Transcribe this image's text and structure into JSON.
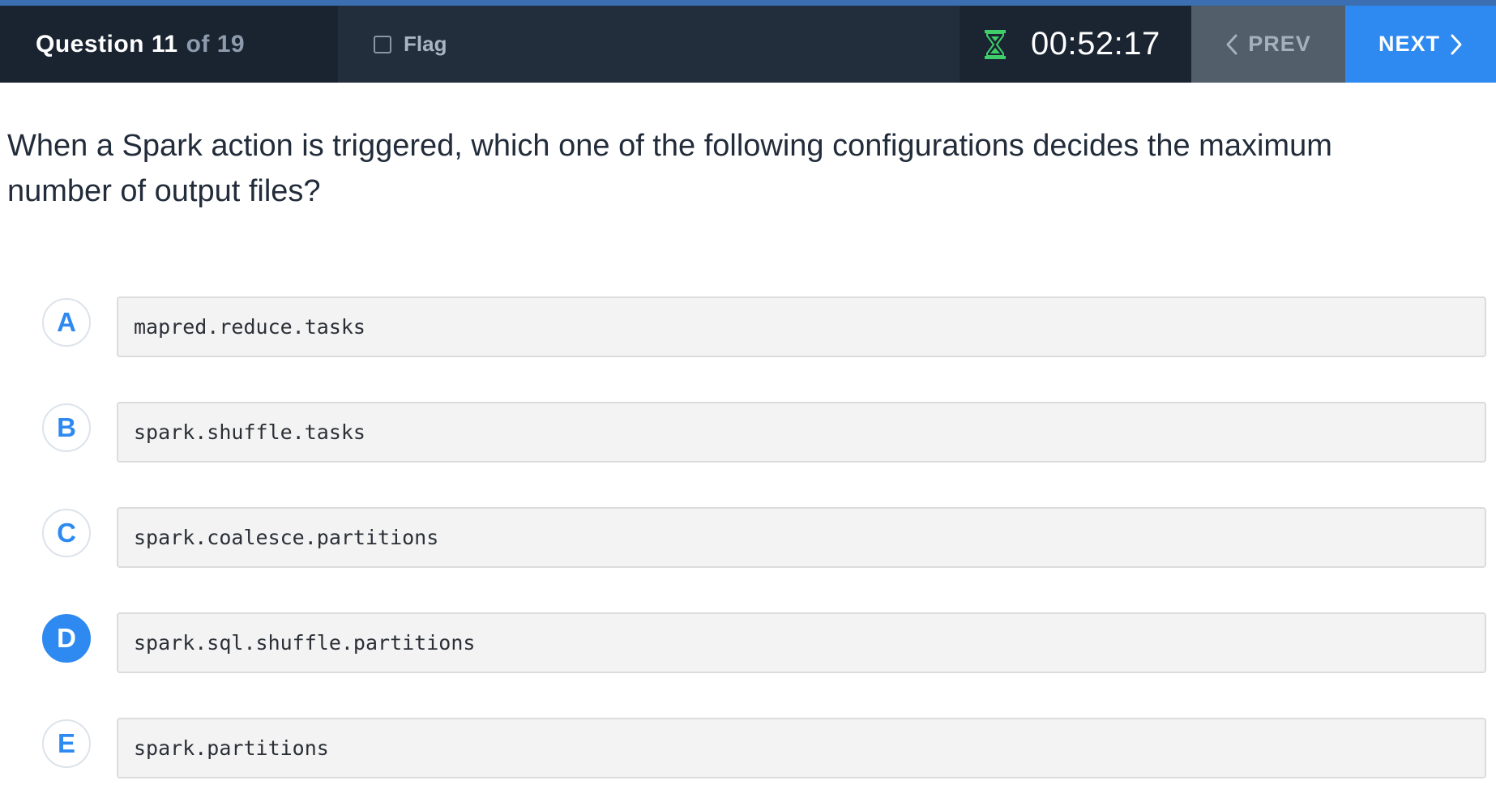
{
  "header": {
    "question_label": "Question 11",
    "question_total": "of 19",
    "flag_label": "Flag",
    "timer": "00:52:17",
    "prev_label": "PREV",
    "next_label": "NEXT"
  },
  "question": {
    "text": "When a Spark action is triggered, which one of the following configurations decides the maximum number of output files?"
  },
  "options": [
    {
      "letter": "A",
      "text": "mapred.reduce.tasks"
    },
    {
      "letter": "B",
      "text": "spark.shuffle.tasks"
    },
    {
      "letter": "C",
      "text": "spark.coalesce.partitions"
    },
    {
      "letter": "D",
      "text": "spark.sql.shuffle.partitions"
    },
    {
      "letter": "E",
      "text": "spark.partitions"
    }
  ],
  "selected_option": "D",
  "colors": {
    "accent": "#2e8af0",
    "header_bg": "#1d2735",
    "timer_icon": "#3ecf6a"
  },
  "icons": {
    "timer": "hourglass-icon",
    "prev": "chevron-left-icon",
    "next": "chevron-right-icon"
  }
}
